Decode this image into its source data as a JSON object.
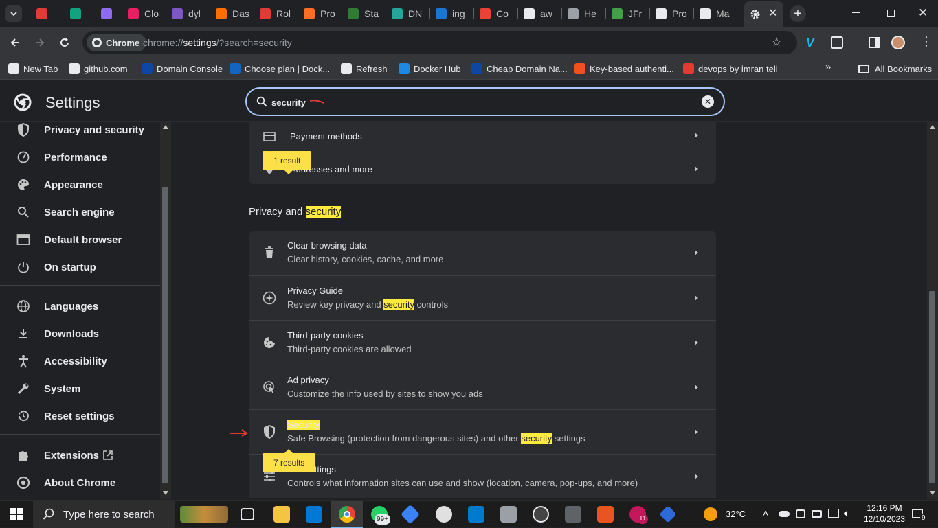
{
  "browser": {
    "tabs": [
      {
        "label": "",
        "color": "#e53935"
      },
      {
        "label": "",
        "color": "#10a37f"
      },
      {
        "label": "",
        "color": "#8e6cf1"
      },
      {
        "label": "Clo",
        "color": "#e91e63"
      },
      {
        "label": "dyl",
        "color": "#7e57c2"
      },
      {
        "label": "Das",
        "color": "#ff6f00"
      },
      {
        "label": "Rol",
        "color": "#e53935"
      },
      {
        "label": "Pro",
        "color": "#fc6d26"
      },
      {
        "label": "Sta",
        "color": "#2e7d32"
      },
      {
        "label": "DN",
        "color": "#26a69a"
      },
      {
        "label": "ing",
        "color": "#1976d2"
      },
      {
        "label": "Co",
        "color": "#ea4335"
      },
      {
        "label": "aw",
        "color": "#e8eaed"
      },
      {
        "label": "He",
        "color": "#9aa0a6"
      },
      {
        "label": "JFr",
        "color": "#43a047"
      },
      {
        "label": "Pro",
        "color": "#e8eaed"
      },
      {
        "label": "Ma",
        "color": "#e8eaed"
      }
    ],
    "active_tab_icon": "gear-icon",
    "omnibox": {
      "chip": "Chrome",
      "url_prefix": "chrome://",
      "url_host": "settings",
      "url_rest": "/?search=security"
    },
    "bookmarks": [
      {
        "label": "New Tab",
        "color": "#e8eaed"
      },
      {
        "label": "github.com",
        "color": "#e8eaed"
      },
      {
        "label": "Domain Console",
        "color": "#0d47a1"
      },
      {
        "label": "Choose plan | Dock...",
        "color": "#1565c0"
      },
      {
        "label": "Refresh",
        "color": "#e8eaed"
      },
      {
        "label": "Docker Hub",
        "color": "#1e88e5"
      },
      {
        "label": "Cheap Domain Na...",
        "color": "#0d47a1"
      },
      {
        "label": "Key-based authenti...",
        "color": "#f25022"
      },
      {
        "label": "devops by imran teli",
        "color": "#e53935"
      }
    ],
    "all_bookmarks": "All Bookmarks"
  },
  "settings": {
    "title": "Settings",
    "search_value": "security",
    "sidebar": [
      {
        "label": "Privacy and security",
        "icon": "shield-icon"
      },
      {
        "label": "Performance",
        "icon": "speedometer-icon"
      },
      {
        "label": "Appearance",
        "icon": "palette-icon"
      },
      {
        "label": "Search engine",
        "icon": "search-icon"
      },
      {
        "label": "Default browser",
        "icon": "browser-icon"
      },
      {
        "label": "On startup",
        "icon": "power-icon"
      },
      {
        "label": "Languages",
        "icon": "globe-icon"
      },
      {
        "label": "Downloads",
        "icon": "download-icon"
      },
      {
        "label": "Accessibility",
        "icon": "accessibility-icon"
      },
      {
        "label": "System",
        "icon": "wrench-icon"
      },
      {
        "label": "Reset settings",
        "icon": "history-icon"
      },
      {
        "label": "Extensions",
        "icon": "puzzle-icon"
      },
      {
        "label": "About Chrome",
        "icon": "chrome-icon"
      }
    ],
    "autofill_rows": [
      {
        "title": "Payment methods"
      },
      {
        "title": "Addresses and more"
      }
    ],
    "bubble_top": "1 result",
    "section_title_plain": "Privacy and ",
    "section_title_hl": "security",
    "privacy_rows": [
      {
        "title": "Clear browsing data",
        "sub": "Clear history, cookies, cache, and more"
      },
      {
        "title": "Privacy Guide",
        "sub_a": "Review key privacy and ",
        "sub_hl": "security",
        "sub_b": " controls"
      },
      {
        "title": "Third-party cookies",
        "sub": "Third-party cookies are allowed"
      },
      {
        "title": "Ad privacy",
        "sub": "Customize the info used by sites to show you ads"
      },
      {
        "title_hl": "Security",
        "sub_a": "Safe Browsing (protection from dangerous sites) and other ",
        "sub_hl": "security",
        "sub_b": " settings"
      },
      {
        "title": "Site settings",
        "sub": "Controls what information sites can use and show (location, camera, pop-ups, and more)"
      }
    ],
    "bubble_bottom": "7 results"
  },
  "taskbar": {
    "search_placeholder": "Type here to search",
    "whatsapp_badge": "99+",
    "copilot_badge": "11",
    "temperature": "32°C",
    "time": "12:16 PM",
    "date": "12/10/2023",
    "notification_count": "9"
  },
  "colors": {
    "highlight": "#ffeb3b",
    "accent": "#a8c7fa",
    "annotation": "#e53935"
  }
}
